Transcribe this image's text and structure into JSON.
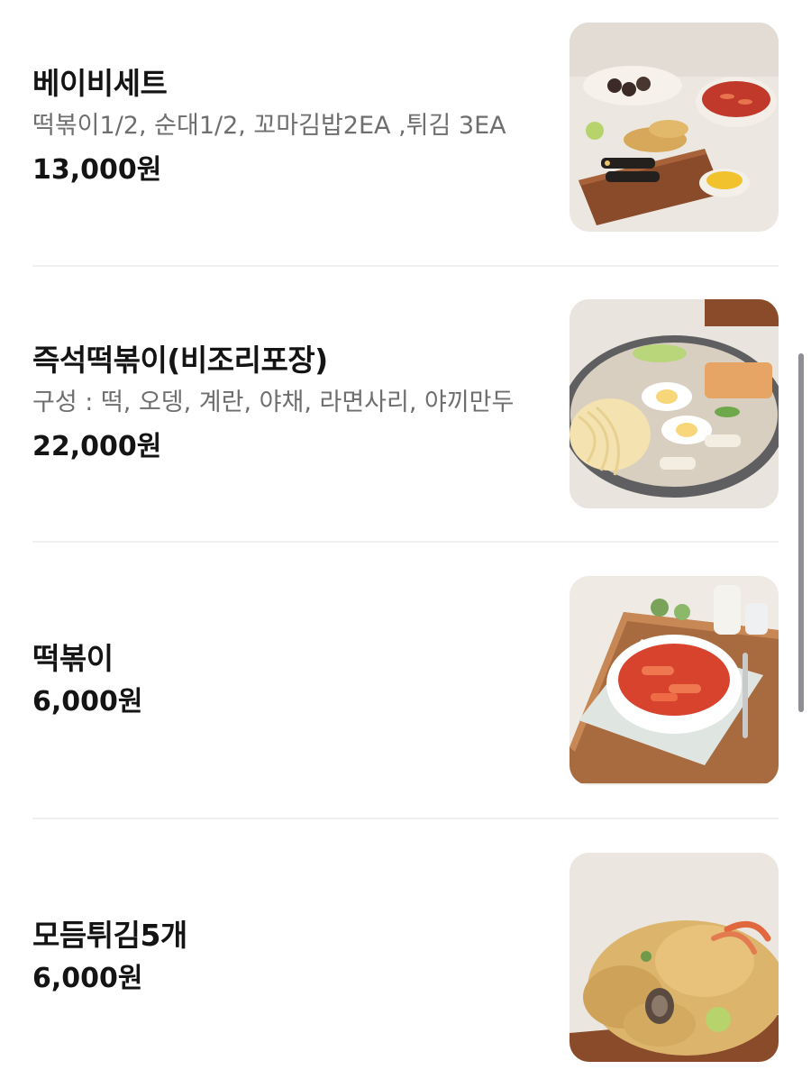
{
  "menu": {
    "items": [
      {
        "name": "베이비세트",
        "description": "떡볶이1/2, 순대1/2, 꼬마김밥2EA ,튀김 3EA",
        "price": "13,000원",
        "photo_icon": "baby-set-photo-icon"
      },
      {
        "name": "즉석떡볶이(비조리포장)",
        "description": "구성 : 떡, 오뎅, 계란, 야채, 라면사리, 야끼만두",
        "price": "22,000원",
        "photo_icon": "instant-tteokbokki-photo-icon"
      },
      {
        "name": "떡볶이",
        "description": "",
        "price": "6,000원",
        "photo_icon": "tteokbokki-photo-icon"
      },
      {
        "name": "모듬튀김5개",
        "description": "",
        "price": "6,000원",
        "photo_icon": "assorted-fried-photo-icon"
      }
    ]
  },
  "colors": {
    "background": "#ffffff",
    "text_primary": "#141414",
    "text_secondary": "#6e6e6e",
    "divider": "#f0f0f0",
    "scrollbar": "#8e8e93"
  }
}
